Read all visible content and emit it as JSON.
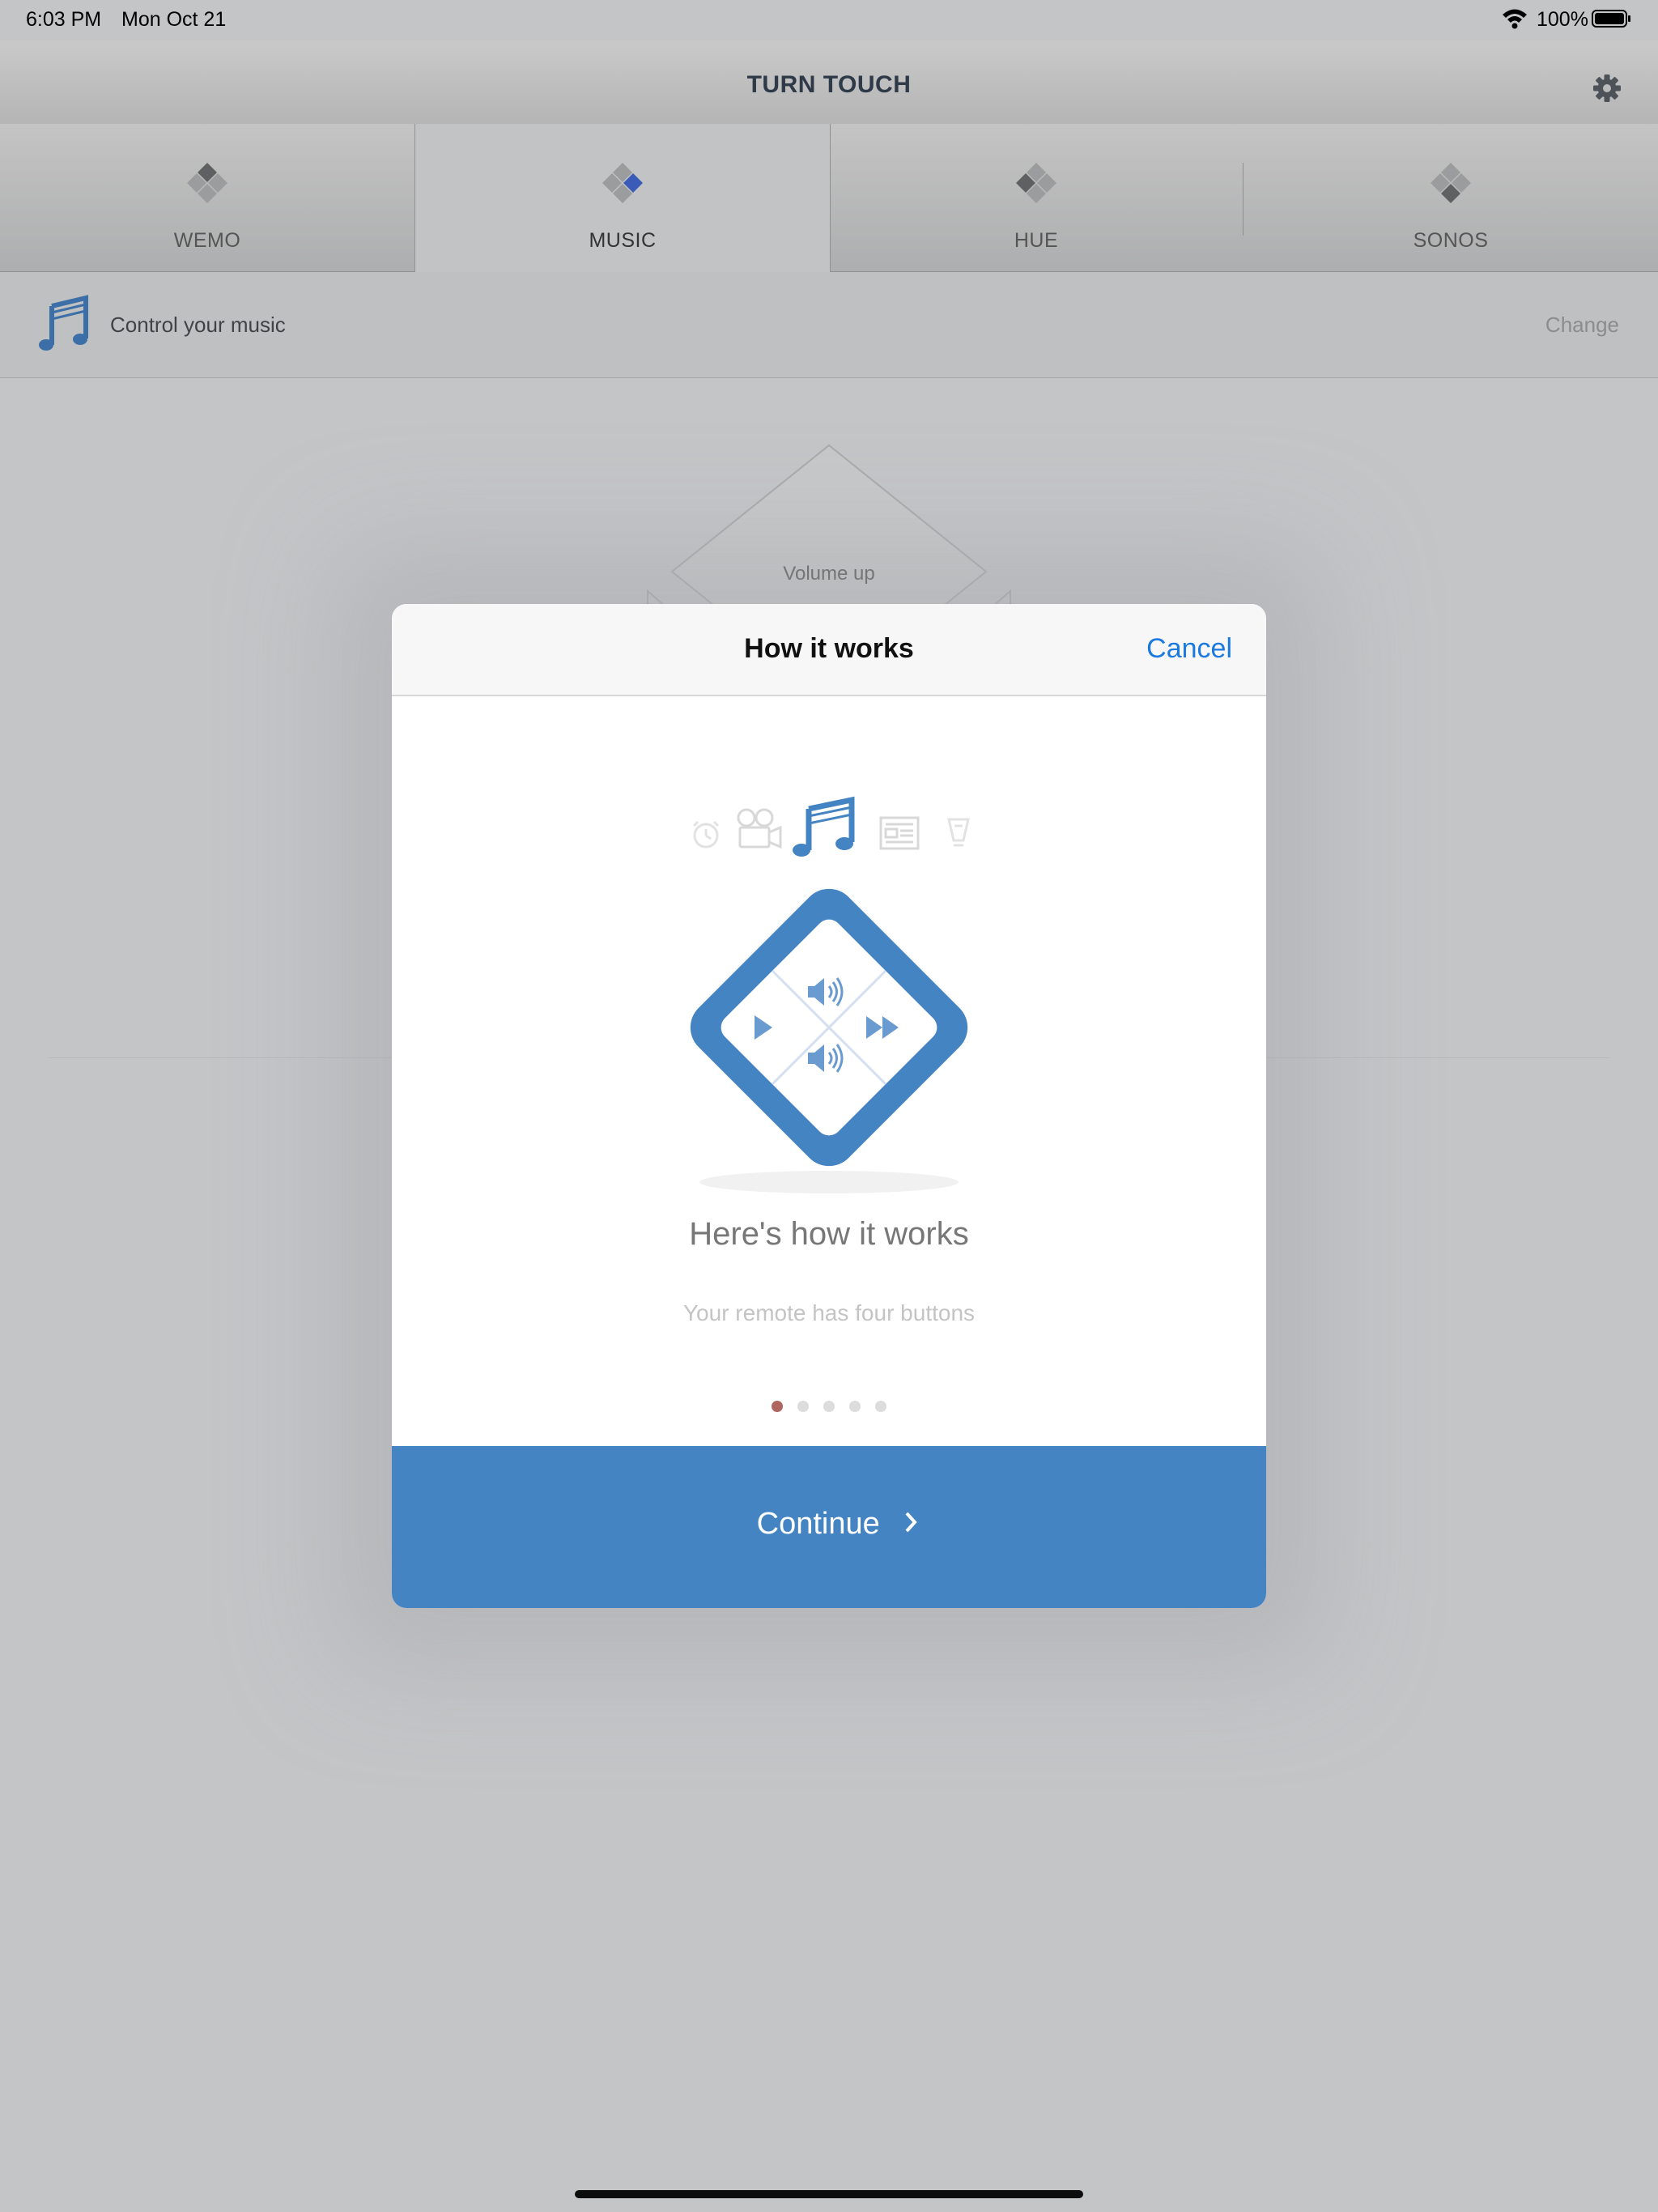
{
  "status_bar": {
    "time": "6:03 PM",
    "date": "Mon Oct 21",
    "battery": "100%"
  },
  "app": {
    "title": "TURN TOUCH"
  },
  "tabs": [
    {
      "label": "WEMO",
      "active": false
    },
    {
      "label": "MUSIC",
      "active": true
    },
    {
      "label": "HUE",
      "active": false
    },
    {
      "label": "SONOS",
      "active": false
    }
  ],
  "mode_bar": {
    "description": "Control your music",
    "change_label": "Change"
  },
  "background_remote": {
    "north_label": "Volume up"
  },
  "modal": {
    "title": "How it works",
    "cancel_label": "Cancel",
    "mode_icons": [
      "alarm-clock-icon",
      "video-camera-icon",
      "music-note-icon",
      "news-icon",
      "light-bulb-icon"
    ],
    "heading": "Here's how it works",
    "subtext": "Your remote has four buttons",
    "page_count": 5,
    "current_page": 1,
    "continue_label": "Continue"
  },
  "colors": {
    "accent": "#4484c3",
    "link": "#1a7ae0",
    "active_dot": "#b06660"
  }
}
